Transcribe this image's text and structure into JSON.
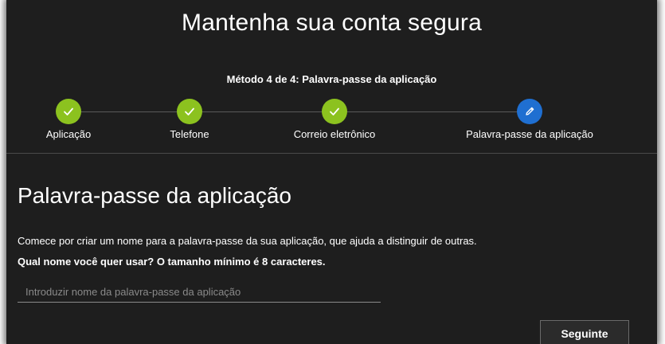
{
  "page": {
    "title": "Mantenha sua conta segura",
    "method_label": "Método 4 de 4: Palavra-passe da aplicação"
  },
  "colors": {
    "background": "#1e1e1e",
    "step_done": "#8cc21f",
    "step_current": "#1f6fd1",
    "text": "#ffffff"
  },
  "steps": [
    {
      "label": "Aplicação",
      "state": "done",
      "icon": "check-icon"
    },
    {
      "label": "Telefone",
      "state": "done",
      "icon": "check-icon"
    },
    {
      "label": "Correio eletrônico",
      "state": "done",
      "icon": "check-icon"
    },
    {
      "label": "Palavra-passe da aplicação",
      "state": "current",
      "icon": "pencil-icon"
    }
  ],
  "section": {
    "title": "Palavra-passe da aplicação",
    "description": "Comece por criar um nome para a palavra-passe da sua aplicação, que ajuda a distinguir de outras.",
    "question": "Qual nome você quer usar? O tamanho mínimo é 8 caracteres.",
    "input_value": "",
    "input_placeholder": "Introduzir nome da palavra-passe da aplicação"
  },
  "actions": {
    "next_label": "Seguinte"
  }
}
